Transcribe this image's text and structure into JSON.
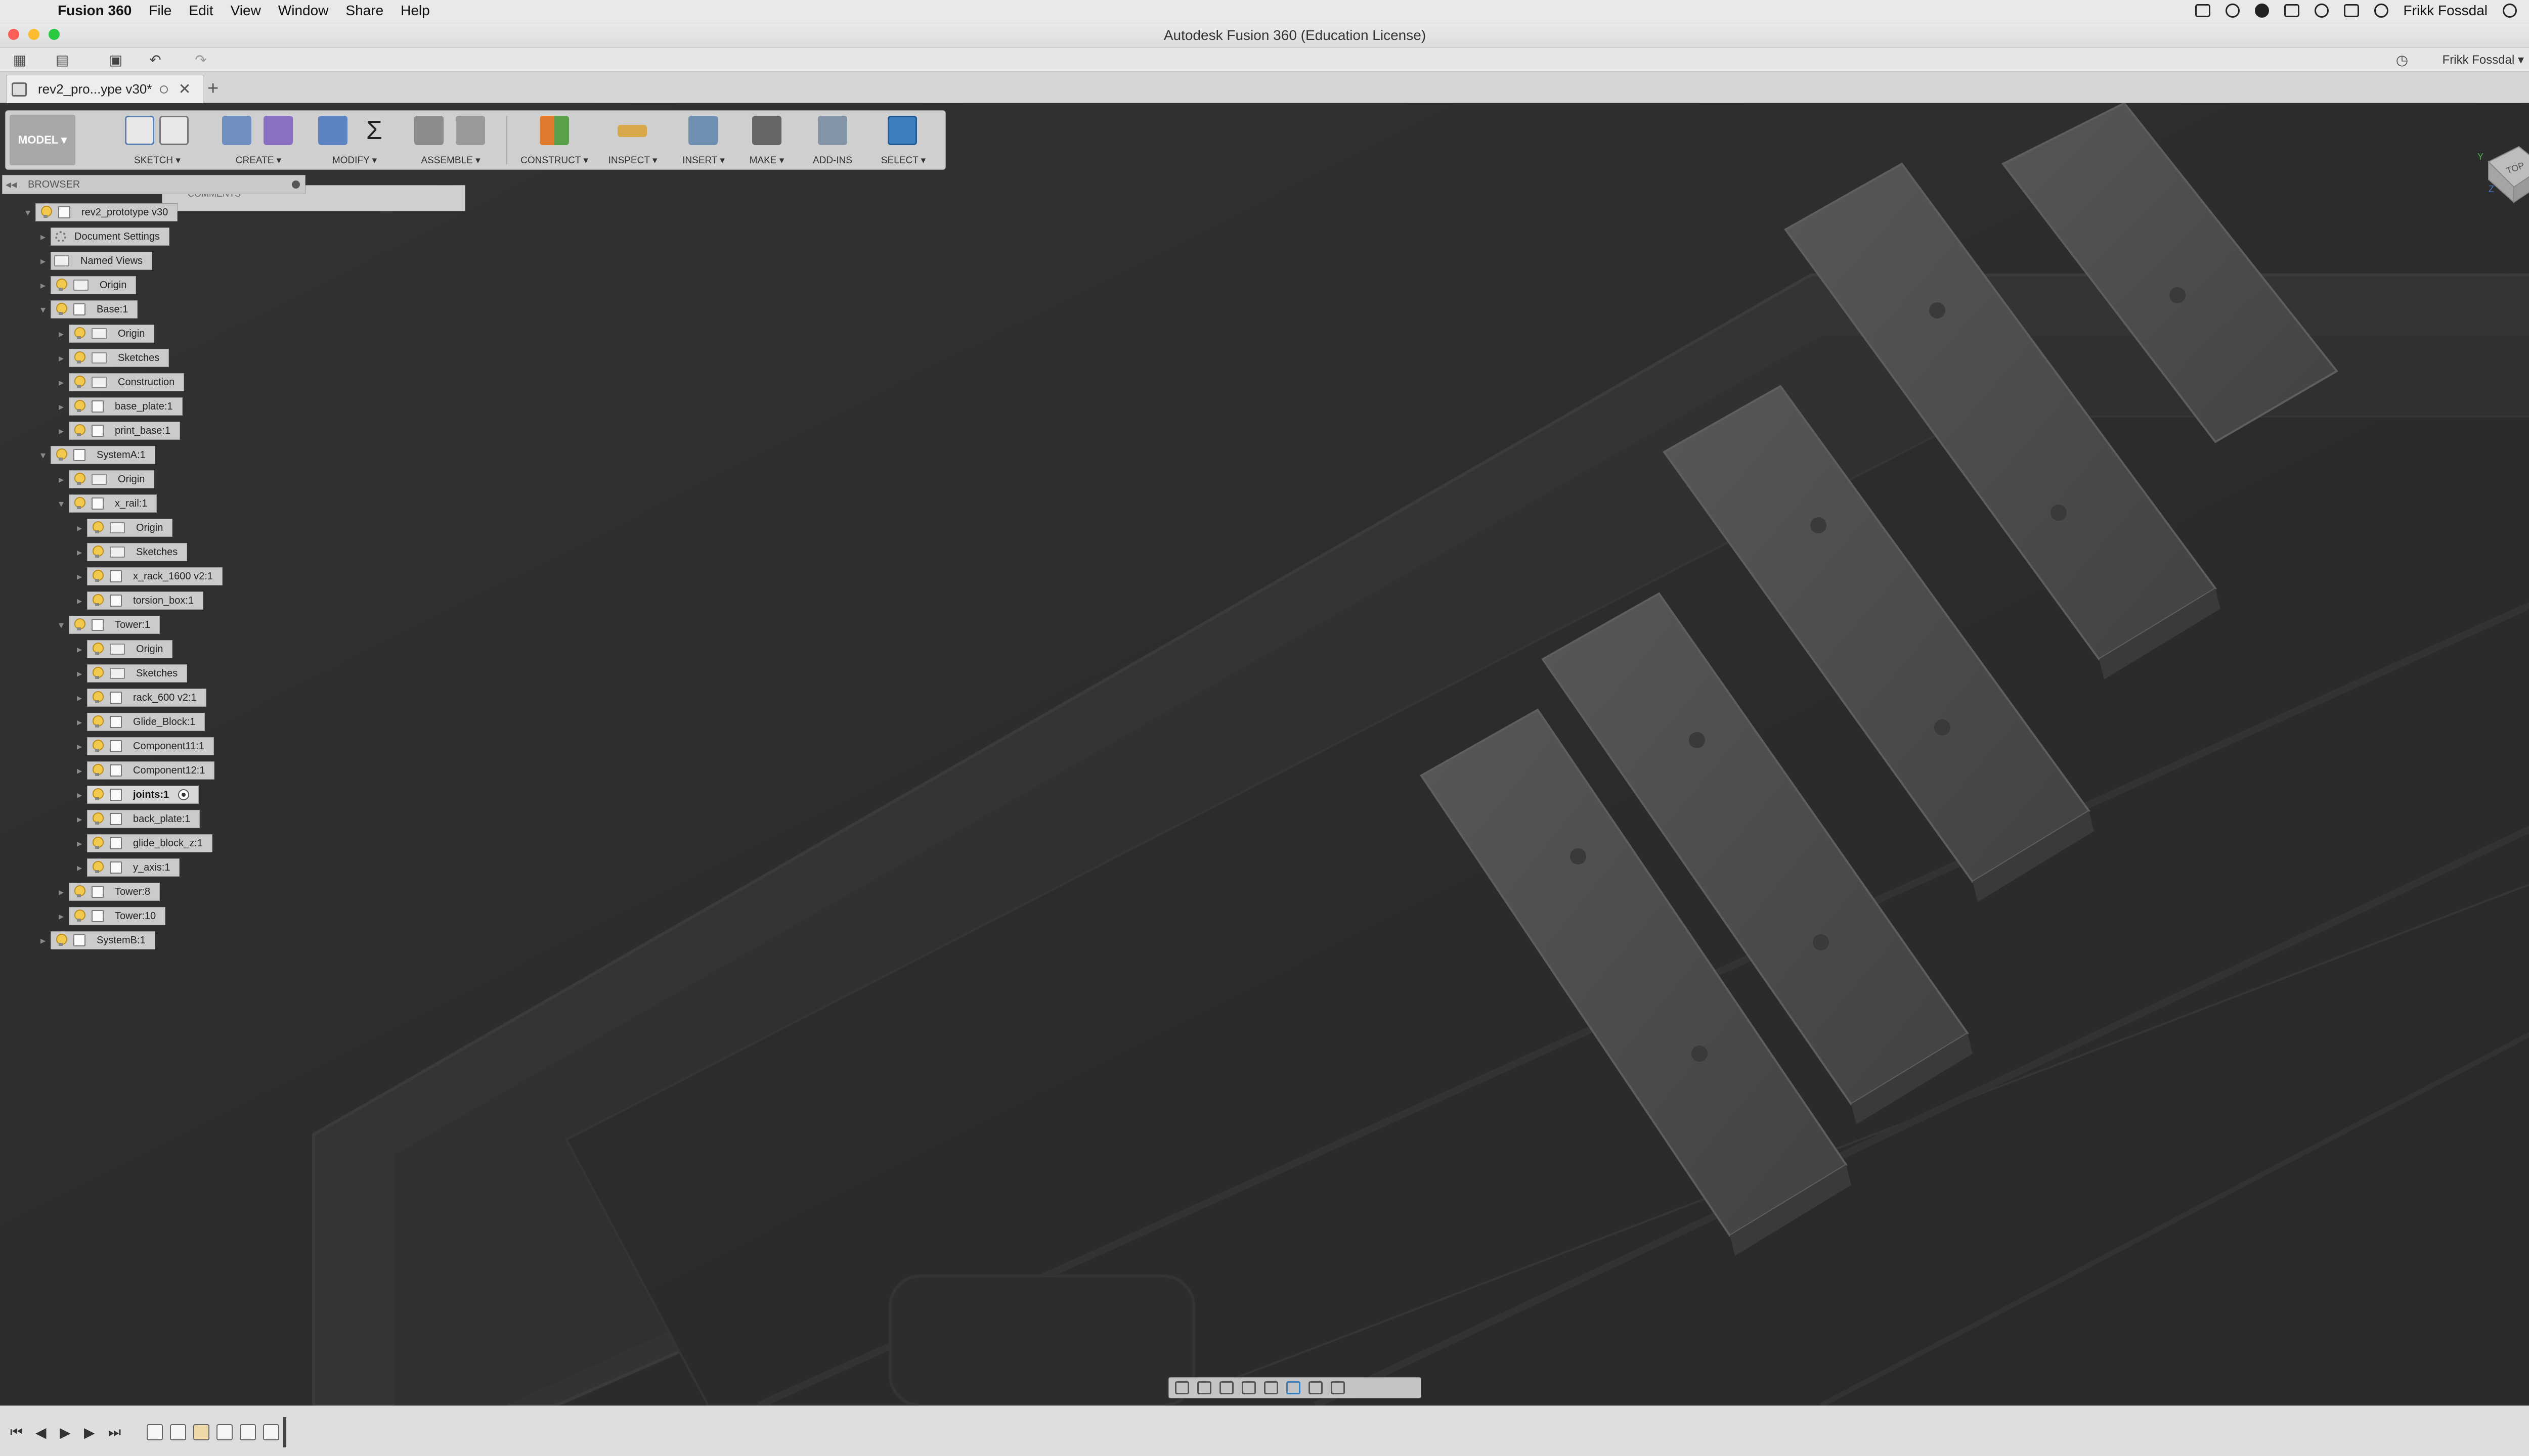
{
  "menubar": {
    "app": "Fusion 360",
    "items": [
      "File",
      "Edit",
      "View",
      "Window",
      "Share",
      "Help"
    ],
    "user": "Frikk Fossdal"
  },
  "window": {
    "title": "Autodesk Fusion 360 (Education License)"
  },
  "toolbar": {
    "user_label": "Frikk Fossdal ▾"
  },
  "tab": {
    "label": "rev2_pro...ype v30*",
    "new_tab": "+"
  },
  "ribbon": {
    "workspace": "MODEL ▾",
    "groups": [
      "SKETCH ▾",
      "CREATE ▾",
      "MODIFY ▾",
      "ASSEMBLE ▾",
      "CONSTRUCT ▾",
      "INSPECT ▾",
      "INSERT ▾",
      "MAKE ▾",
      "ADD-INS",
      "SELECT ▾"
    ]
  },
  "browser": {
    "title": "BROWSER",
    "comments": "COMMENTS",
    "tree": [
      {
        "label": "rev2_prototype v30",
        "icon": "component-icon"
      },
      {
        "label": "Document Settings",
        "icon": "gear-icon"
      },
      {
        "label": "Named Views",
        "icon": "folder-icon"
      },
      {
        "label": "Origin",
        "icon": "folder-icon"
      },
      {
        "label": "Base:1",
        "icon": "component-icon"
      },
      {
        "label": "Origin",
        "icon": "folder-icon"
      },
      {
        "label": "Sketches",
        "icon": "folder-icon"
      },
      {
        "label": "Construction",
        "icon": "folder-icon"
      },
      {
        "label": "base_plate:1",
        "icon": "component-icon"
      },
      {
        "label": "print_base:1",
        "icon": "component-icon"
      },
      {
        "label": "SystemA:1",
        "icon": "component-icon"
      },
      {
        "label": "Origin",
        "icon": "folder-icon"
      },
      {
        "label": "x_rail:1",
        "icon": "component-icon"
      },
      {
        "label": "Origin",
        "icon": "folder-icon"
      },
      {
        "label": "Sketches",
        "icon": "folder-icon"
      },
      {
        "label": "x_rack_1600 v2:1",
        "icon": "component-icon"
      },
      {
        "label": "torsion_box:1",
        "icon": "component-icon"
      },
      {
        "label": "Tower:1",
        "icon": "component-icon"
      },
      {
        "label": "Origin",
        "icon": "folder-icon"
      },
      {
        "label": "Sketches",
        "icon": "folder-icon"
      },
      {
        "label": "rack_600 v2:1",
        "icon": "component-icon"
      },
      {
        "label": "Glide_Block:1",
        "icon": "component-icon"
      },
      {
        "label": "Component11:1",
        "icon": "component-icon"
      },
      {
        "label": "Component12:1",
        "icon": "component-icon"
      },
      {
        "label": "joints:1",
        "icon": "component-icon"
      },
      {
        "label": "back_plate:1",
        "icon": "component-icon"
      },
      {
        "label": "glide_block_z:1",
        "icon": "component-icon"
      },
      {
        "label": "y_axis:1",
        "icon": "component-icon"
      },
      {
        "label": "Tower:8",
        "icon": "component-icon"
      },
      {
        "label": "Tower:10",
        "icon": "component-icon"
      },
      {
        "label": "SystemB:1",
        "icon": "component-icon"
      }
    ]
  },
  "viewcube": {
    "face": "TOP",
    "axis_y": "Y",
    "axis_x": "X",
    "axis_z": "Z"
  },
  "colors": {
    "viewport_bg": "#303030",
    "part_fill": "#4a4a4a",
    "select_accent": "#3b7fbf"
  }
}
